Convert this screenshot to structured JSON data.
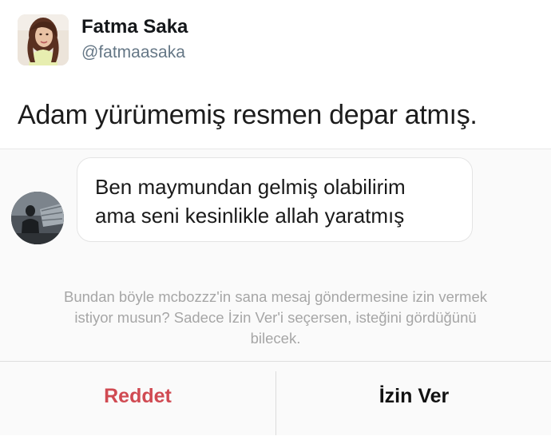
{
  "tweet": {
    "author_name": "Fatma Saka",
    "author_handle": "@fatmaasaka",
    "text": "Adam yürümemiş resmen depar atmış."
  },
  "message_request": {
    "message_lines": [
      "Ben maymundan gelmiş olabilirim",
      "ama seni kesinlikle allah yaratmış"
    ],
    "notice_lines": [
      "Bundan böyle mcbozzz'in sana mesaj göndermesine izin vermek",
      "istiyor musun? Sadece İzin Ver'i seçersen, isteğini gördüğünü",
      "bilecek."
    ],
    "reject_label": "Reddet",
    "accept_label": "İzin Ver"
  },
  "colors": {
    "reject": "#d04a52",
    "accept": "#111111",
    "notice": "#a6a6a6",
    "handle": "#657786"
  },
  "icons": {
    "author_avatar": "profile-photo",
    "sender_avatar": "profile-photo"
  }
}
